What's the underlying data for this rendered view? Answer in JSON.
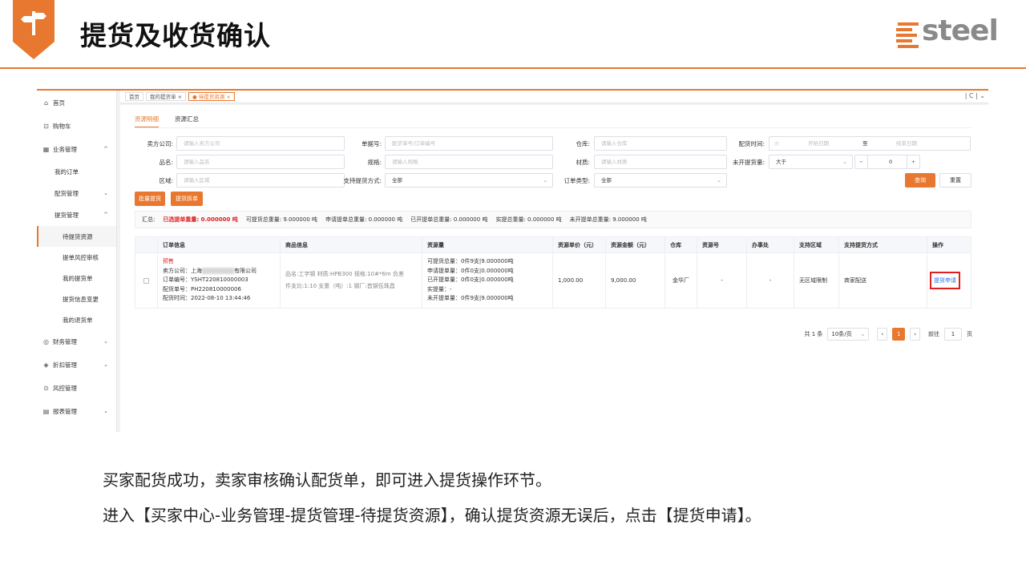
{
  "slide": {
    "title": "提货及收货确认",
    "logo_text": "steel",
    "captions": [
      "买家配货成功，卖家审核确认配货单，即可进入提货操作环节。",
      "进入【买家中心-业务管理-提货管理-待提货资源】，确认提货资源无误后，点击【提货申请】。"
    ]
  },
  "sidebar": {
    "home": "首页",
    "cart": "购物车",
    "business": "业务管理",
    "my_orders": "我的订单",
    "allocation": "配货管理",
    "pickup": "提货管理",
    "pickup_items": [
      "待提货资源",
      "提单风控审核",
      "我的提货单",
      "提货信息变更",
      "我的退货单"
    ],
    "finance": "财务管理",
    "discount": "折扣管理",
    "risk": "风控管理",
    "reports": "报表管理"
  },
  "tabs": [
    "首页",
    "我的提货单 ×",
    "● 待提货资源 ×"
  ],
  "subtabs": [
    "资源明细",
    "资源汇总"
  ],
  "filters": {
    "seller_label": "卖方公司:",
    "seller_ph": "请输入卖方公司",
    "docno_label": "单据号:",
    "docno_ph": "配货单号/订单编号",
    "warehouse_label": "仓库:",
    "warehouse_ph": "请输入仓库",
    "time_label": "配货时间:",
    "time_start_ph": "开始日期",
    "time_sep": "至",
    "time_end_ph": "结束日期",
    "product_label": "品名:",
    "product_ph": "请输入品名",
    "spec_label": "规格:",
    "spec_ph": "请输入规格",
    "material_label": "材质:",
    "material_ph": "请输入材质",
    "unopened_label": "未开提货量:",
    "unopened_op": "大于",
    "unopened_val": "0",
    "region_label": "区域:",
    "region_ph": "请输入区域",
    "method_label": "支持提货方式:",
    "method_val": "全部",
    "ordertype_label": "订单类型:",
    "ordertype_val": "全部",
    "search": "查询",
    "reset": "重置"
  },
  "actions": {
    "batch": "批量提货",
    "split": "提货拆单"
  },
  "summary": {
    "label": "汇总:",
    "selected": "已选提单重量: 0.000000 吨",
    "available": "可提货总重量: 9.000000 吨",
    "applied": "申请提单总重量: 0.000000 吨",
    "opened": "已开提单总重量: 0.000000 吨",
    "actual": "实提总重量: 0.000000 吨",
    "unopened": "未开提单总重量: 9.000000 吨"
  },
  "table": {
    "headers": [
      "订单信息",
      "商品信息",
      "资源量",
      "资源单价（元）",
      "资源金额（元）",
      "仓库",
      "资源号",
      "办事处",
      "支持区域",
      "支持提货方式",
      "操作"
    ],
    "row": {
      "tag": "预售",
      "seller_prefix": "卖方公司：上海",
      "seller_suffix": "有限公司",
      "order_no": "订单编号：YSHT220810000003",
      "alloc_no": "配货单号：PH220810000006",
      "alloc_time": "配货时间：2022-08-10 13:44:46",
      "goods_line1": "品名:工字钢  材质:HPB300  规格:10#*6m  负差",
      "goods_line2": "件支比:1:10  支重（吨）:1  钢厂:首钢伍珠昌",
      "res1": "可提货总量：0件9支|9.000000吨",
      "res2": "申请提单量：0件0支|0.000000吨",
      "res3": "已开提单量：0件0支|0.000000吨",
      "res4": "实提量：-",
      "res5": "未开提单量：0件9支|9.000000吨",
      "price": "1,000.00",
      "amount": "9,000.00",
      "warehouse": "金华厂",
      "resno": "-",
      "office": "-",
      "region": "无区域限制",
      "method": "商家配送",
      "op": "提货申请"
    }
  },
  "pager": {
    "total": "共 1 条",
    "size": "10条/页",
    "prev": "‹",
    "page": "1",
    "next": "›",
    "goto": "前往",
    "goto_val": "1",
    "unit": "页"
  },
  "colors": {
    "accent": "#e8782f",
    "highlight": "#e02020",
    "link": "#2b6de6"
  }
}
